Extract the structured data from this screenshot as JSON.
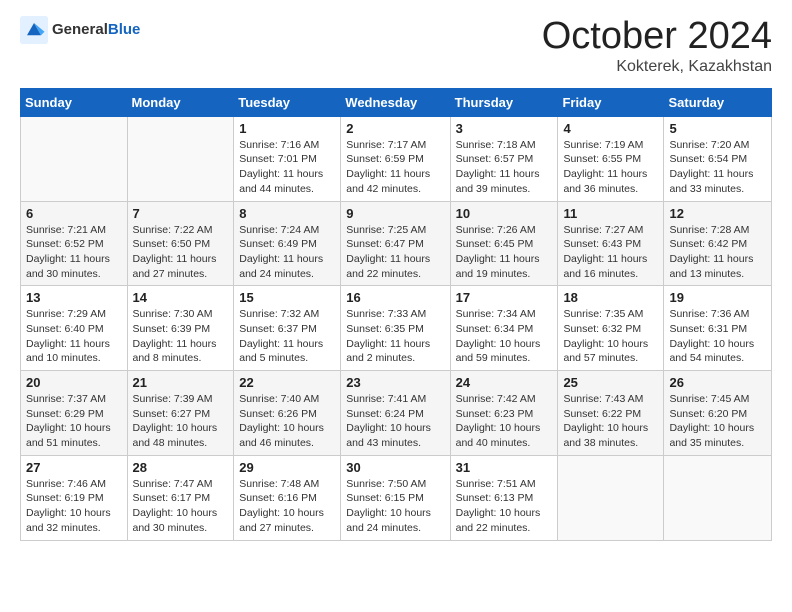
{
  "logo": {
    "general": "General",
    "blue": "Blue"
  },
  "header": {
    "month": "October 2024",
    "location": "Kokterek, Kazakhstan"
  },
  "weekdays": [
    "Sunday",
    "Monday",
    "Tuesday",
    "Wednesday",
    "Thursday",
    "Friday",
    "Saturday"
  ],
  "weeks": [
    [
      {
        "day": null
      },
      {
        "day": null
      },
      {
        "day": "1",
        "sunrise": "Sunrise: 7:16 AM",
        "sunset": "Sunset: 7:01 PM",
        "daylight": "Daylight: 11 hours and 44 minutes."
      },
      {
        "day": "2",
        "sunrise": "Sunrise: 7:17 AM",
        "sunset": "Sunset: 6:59 PM",
        "daylight": "Daylight: 11 hours and 42 minutes."
      },
      {
        "day": "3",
        "sunrise": "Sunrise: 7:18 AM",
        "sunset": "Sunset: 6:57 PM",
        "daylight": "Daylight: 11 hours and 39 minutes."
      },
      {
        "day": "4",
        "sunrise": "Sunrise: 7:19 AM",
        "sunset": "Sunset: 6:55 PM",
        "daylight": "Daylight: 11 hours and 36 minutes."
      },
      {
        "day": "5",
        "sunrise": "Sunrise: 7:20 AM",
        "sunset": "Sunset: 6:54 PM",
        "daylight": "Daylight: 11 hours and 33 minutes."
      }
    ],
    [
      {
        "day": "6",
        "sunrise": "Sunrise: 7:21 AM",
        "sunset": "Sunset: 6:52 PM",
        "daylight": "Daylight: 11 hours and 30 minutes."
      },
      {
        "day": "7",
        "sunrise": "Sunrise: 7:22 AM",
        "sunset": "Sunset: 6:50 PM",
        "daylight": "Daylight: 11 hours and 27 minutes."
      },
      {
        "day": "8",
        "sunrise": "Sunrise: 7:24 AM",
        "sunset": "Sunset: 6:49 PM",
        "daylight": "Daylight: 11 hours and 24 minutes."
      },
      {
        "day": "9",
        "sunrise": "Sunrise: 7:25 AM",
        "sunset": "Sunset: 6:47 PM",
        "daylight": "Daylight: 11 hours and 22 minutes."
      },
      {
        "day": "10",
        "sunrise": "Sunrise: 7:26 AM",
        "sunset": "Sunset: 6:45 PM",
        "daylight": "Daylight: 11 hours and 19 minutes."
      },
      {
        "day": "11",
        "sunrise": "Sunrise: 7:27 AM",
        "sunset": "Sunset: 6:43 PM",
        "daylight": "Daylight: 11 hours and 16 minutes."
      },
      {
        "day": "12",
        "sunrise": "Sunrise: 7:28 AM",
        "sunset": "Sunset: 6:42 PM",
        "daylight": "Daylight: 11 hours and 13 minutes."
      }
    ],
    [
      {
        "day": "13",
        "sunrise": "Sunrise: 7:29 AM",
        "sunset": "Sunset: 6:40 PM",
        "daylight": "Daylight: 11 hours and 10 minutes."
      },
      {
        "day": "14",
        "sunrise": "Sunrise: 7:30 AM",
        "sunset": "Sunset: 6:39 PM",
        "daylight": "Daylight: 11 hours and 8 minutes."
      },
      {
        "day": "15",
        "sunrise": "Sunrise: 7:32 AM",
        "sunset": "Sunset: 6:37 PM",
        "daylight": "Daylight: 11 hours and 5 minutes."
      },
      {
        "day": "16",
        "sunrise": "Sunrise: 7:33 AM",
        "sunset": "Sunset: 6:35 PM",
        "daylight": "Daylight: 11 hours and 2 minutes."
      },
      {
        "day": "17",
        "sunrise": "Sunrise: 7:34 AM",
        "sunset": "Sunset: 6:34 PM",
        "daylight": "Daylight: 10 hours and 59 minutes."
      },
      {
        "day": "18",
        "sunrise": "Sunrise: 7:35 AM",
        "sunset": "Sunset: 6:32 PM",
        "daylight": "Daylight: 10 hours and 57 minutes."
      },
      {
        "day": "19",
        "sunrise": "Sunrise: 7:36 AM",
        "sunset": "Sunset: 6:31 PM",
        "daylight": "Daylight: 10 hours and 54 minutes."
      }
    ],
    [
      {
        "day": "20",
        "sunrise": "Sunrise: 7:37 AM",
        "sunset": "Sunset: 6:29 PM",
        "daylight": "Daylight: 10 hours and 51 minutes."
      },
      {
        "day": "21",
        "sunrise": "Sunrise: 7:39 AM",
        "sunset": "Sunset: 6:27 PM",
        "daylight": "Daylight: 10 hours and 48 minutes."
      },
      {
        "day": "22",
        "sunrise": "Sunrise: 7:40 AM",
        "sunset": "Sunset: 6:26 PM",
        "daylight": "Daylight: 10 hours and 46 minutes."
      },
      {
        "day": "23",
        "sunrise": "Sunrise: 7:41 AM",
        "sunset": "Sunset: 6:24 PM",
        "daylight": "Daylight: 10 hours and 43 minutes."
      },
      {
        "day": "24",
        "sunrise": "Sunrise: 7:42 AM",
        "sunset": "Sunset: 6:23 PM",
        "daylight": "Daylight: 10 hours and 40 minutes."
      },
      {
        "day": "25",
        "sunrise": "Sunrise: 7:43 AM",
        "sunset": "Sunset: 6:22 PM",
        "daylight": "Daylight: 10 hours and 38 minutes."
      },
      {
        "day": "26",
        "sunrise": "Sunrise: 7:45 AM",
        "sunset": "Sunset: 6:20 PM",
        "daylight": "Daylight: 10 hours and 35 minutes."
      }
    ],
    [
      {
        "day": "27",
        "sunrise": "Sunrise: 7:46 AM",
        "sunset": "Sunset: 6:19 PM",
        "daylight": "Daylight: 10 hours and 32 minutes."
      },
      {
        "day": "28",
        "sunrise": "Sunrise: 7:47 AM",
        "sunset": "Sunset: 6:17 PM",
        "daylight": "Daylight: 10 hours and 30 minutes."
      },
      {
        "day": "29",
        "sunrise": "Sunrise: 7:48 AM",
        "sunset": "Sunset: 6:16 PM",
        "daylight": "Daylight: 10 hours and 27 minutes."
      },
      {
        "day": "30",
        "sunrise": "Sunrise: 7:50 AM",
        "sunset": "Sunset: 6:15 PM",
        "daylight": "Daylight: 10 hours and 24 minutes."
      },
      {
        "day": "31",
        "sunrise": "Sunrise: 7:51 AM",
        "sunset": "Sunset: 6:13 PM",
        "daylight": "Daylight: 10 hours and 22 minutes."
      },
      {
        "day": null
      },
      {
        "day": null
      }
    ]
  ]
}
